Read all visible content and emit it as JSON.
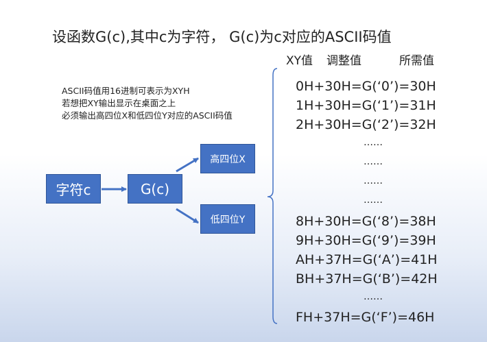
{
  "title": "设函数G(c),其中c为字符，  G(c)为c对应的ASCII码值",
  "columns": {
    "xy": "XY值",
    "adjust": "调整值",
    "needed": "所需值"
  },
  "notes": [
    "ASCII码值用16进制可表示为XYH",
    "若想把XY输出显示在桌面之上",
    "必须输出高四位X和低四位Y对应的ASCII码值"
  ],
  "boxes": {
    "char": "字符c",
    "g": "G(c)",
    "high": "高四位X",
    "low": "低四位Y"
  },
  "rows": [
    "0H+30H=G(‘0’)=30H",
    "1H+30H=G(‘1’)=31H",
    "2H+30H=G(‘2’)=32H",
    "……",
    "……",
    "……",
    "……",
    "8H+30H=G(‘8’)=38H",
    "9H+30H=G(‘9’)=39H",
    "AH+37H=G(‘A’)=41H",
    "BH+37H=G(‘B’)=42H",
    "……",
    "FH+37H=G(‘F’)=46H"
  ],
  "colors": {
    "box_fill": "#4472c4",
    "box_border": "#2f5597",
    "connector": "#4472c4"
  }
}
